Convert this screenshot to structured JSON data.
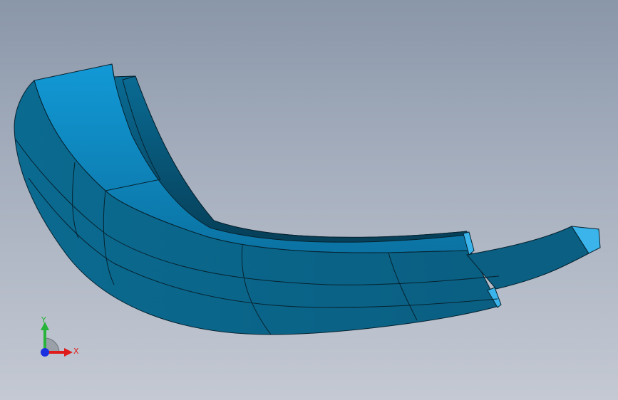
{
  "viewport": {
    "colors": {
      "background_top": "#8a97a9",
      "background_bottom": "#c4c9d3",
      "part_top_face": "#0d8dc6",
      "part_side_face": "#0a5f82",
      "part_end_face": "#3ab4ea",
      "edge_line": "#06222f"
    },
    "model": {
      "icon": "curved-bracket-part-icon"
    }
  },
  "triad": {
    "x_label": "X",
    "y_label": "Y",
    "colors": {
      "x": "#e01b1b",
      "y": "#28b43a",
      "z": "#1a2fe0"
    }
  }
}
